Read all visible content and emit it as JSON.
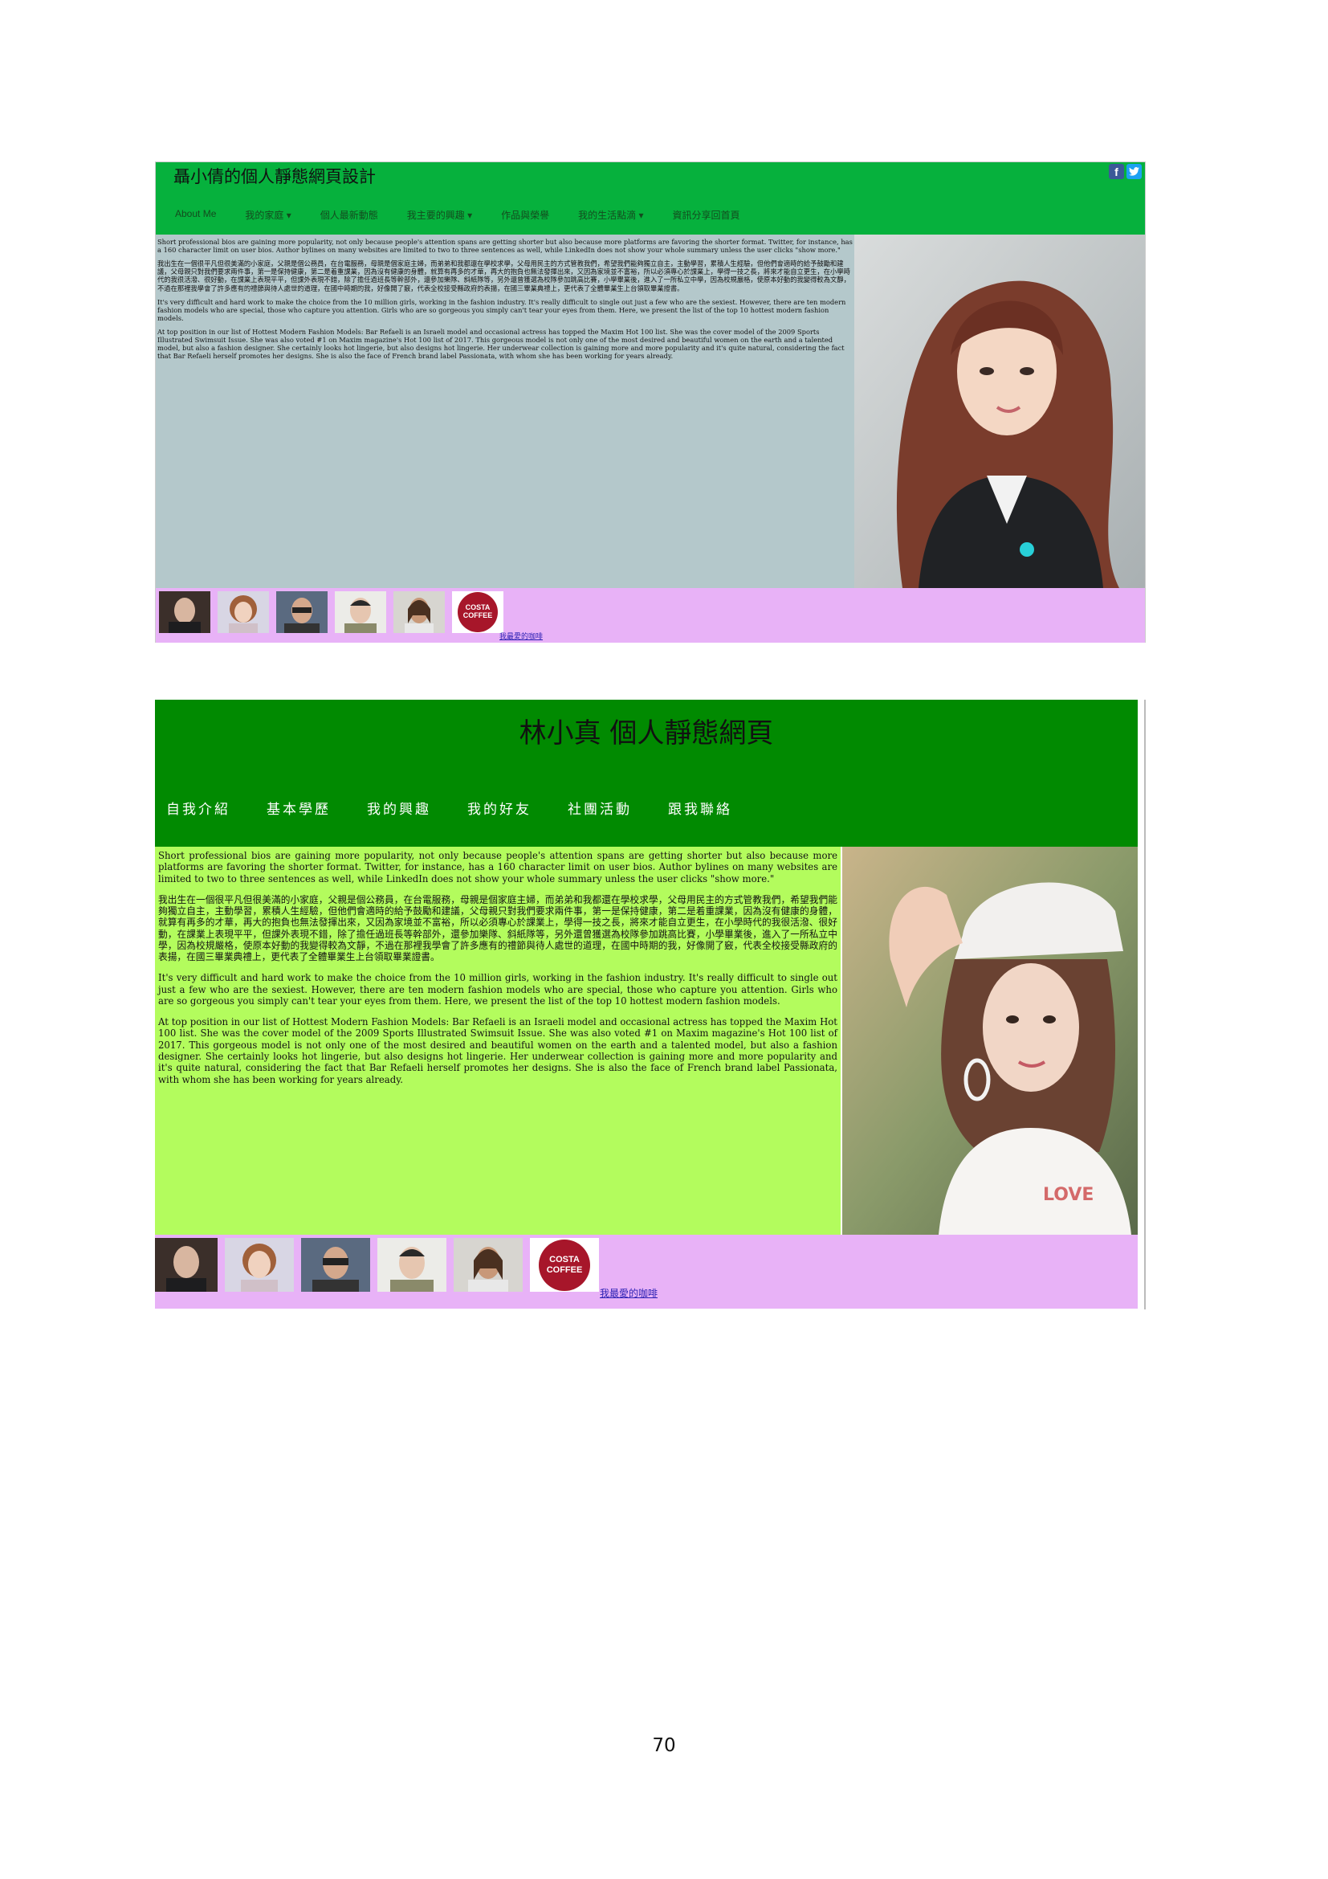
{
  "screenshot1": {
    "title": "聶小倩的個人靜態網頁設計",
    "social": {
      "facebook": "f",
      "twitter": "t"
    },
    "nav": [
      "About Me",
      "我的家庭 ▾",
      "個人最新動態",
      "我主要的興趣 ▾",
      "作品與榮譽",
      "我的生活點滴 ▾",
      "資訊分享回首頁"
    ],
    "paragraphs": [
      "Short professional bios are gaining more popularity, not only because people's attention spans are getting shorter but also because more platforms are favoring the shorter format. Twitter, for instance, has a 160 character limit on user bios. Author bylines on many websites are limited to two to three sentences as well, while LinkedIn does not show your whole summary unless the user clicks \"show more.\"",
      "我出生在一個很平凡但很美滿的小家庭，父親是個公務員，在台電服務，母親是個家庭主婦，而弟弟和我都還在學校求學，父母用民主的方式管教我們，希望我們能夠獨立自主，主動學習，累積人生經驗，但他們會適時的給予鼓勵和建議，父母親只對我們要求兩件事，第一是保持健康，第二是着重課業，因為沒有健康的身體，就算有再多的才華，再大的抱負也無法發揮出來，又因為家境並不富裕，所以必須專心於課業上，學得一技之長，將來才能自立更生，在小學時代的我很活潑、很好動，在課業上表現平平，但課外表現不錯，除了擔任過班長等幹部外，還參加樂隊、斜紙隊等，另外還曾獲選為校隊參加跳高比賽，小學畢業後，進入了一所私立中學，因為校規嚴格，使原本好動的我變得較為文靜，不過在那裡我學會了許多應有的禮節與待人處世的道理，在國中時期的我，好像開了竅，代表全校接受縣政府的表揚，在國三畢業典禮上，更代表了全體畢業生上台領取畢業證書。",
      "It's very difficult and hard work to make the choice from the 10 million girls, working in the fashion industry. It's really difficult to single out just a few who are the sexiest. However, there are ten modern fashion models who are special, those who capture you attention. Girls who are so gorgeous you simply can't tear your eyes from them. Here, we present the list of the top 10 hottest modern fashion models.",
      "At top position in our list of Hottest Modern Fashion Models: Bar Refaeli is an Israeli model and occasional actress has topped the Maxim Hot 100 list. She was the cover model of the 2009 Sports Illustrated Swimsuit Issue. She was also voted #1 on Maxim magazine's Hot 100 list of 2017. This gorgeous model is not only one of the most desired and beautiful women on the earth and a talented model, but also a fashion designer. She certainly looks hot lingerie, but also designs hot lingerie. Her underwear collection is gaining more and more popularity and it's quite natural, considering the fact that Bar Refaeli herself promotes her designs. She is also the face of French brand label Passionata, with whom she has been working for years already."
    ],
    "costa_logo_text": "COSTA COFFEE",
    "footer_link": "我最愛的咖啡"
  },
  "screenshot2": {
    "title": "林小真 個人靜態網頁",
    "nav": [
      "自我介紹",
      "基本學歷",
      "我的興趣",
      "我的好友",
      "社團活動",
      "跟我聯絡"
    ],
    "paragraphs": [
      "Short professional bios are gaining more popularity, not only because people's attention spans are getting shorter but also because more platforms are favoring the shorter format. Twitter, for instance, has a 160 character limit on user bios. Author bylines on many websites are limited to two to three sentences as well, while LinkedIn does not show your whole summary unless the user clicks \"show more.\"",
      "我出生在一個很平凡但很美滿的小家庭，父親是個公務員，在台電服務，母親是個家庭主婦，而弟弟和我都還在學校求學，父母用民主的方式管教我們，希望我們能夠獨立自主，主動學習，累積人生經驗，但他們會適時的給予鼓勵和建議，父母親只對我們要求兩件事，第一是保持健康，第二是着重課業，因為沒有健康的身體，就算有再多的才華，再大的抱負也無法發揮出來，又因為家境並不富裕，所以必須專心於課業上，學得一技之長，將來才能自立更生，在小學時代的我很活潑、很好動，在課業上表現平平，但課外表現不錯，除了擔任過班長等幹部外，還參加樂隊、斜紙隊等，另外還曾獲選為校隊參加跳高比賽，小學畢業後，進入了一所私立中學，因為校規嚴格，使原本好動的我變得較為文靜，不過在那裡我學會了許多應有的禮節與待人處世的道理，在國中時期的我，好像開了竅，代表全校接受縣政府的表揚，在國三畢業典禮上，更代表了全體畢業生上台領取畢業證書。",
      "It's very difficult and hard work to make the choice from the 10 million girls, working in the fashion industry. It's really difficult to single out just a few who are the sexiest. However, there are ten modern fashion models who are special, those who capture you attention. Girls who are so gorgeous you simply can't tear your eyes from them. Here, we present the list of the top 10 hottest modern fashion models.",
      "At top position in our list of Hottest Modern Fashion Models: Bar Refaeli is an Israeli model and occasional actress has topped the Maxim Hot 100 list. She was the cover model of the 2009 Sports Illustrated Swimsuit Issue. She was also voted #1 on Maxim magazine's Hot 100 list of 2017. This gorgeous model is not only one of the most desired and beautiful women on the earth and a talented model, but also a fashion designer. She certainly looks hot lingerie, but also designs hot lingerie. Her underwear collection is gaining more and more popularity and it's quite natural, considering the fact that Bar Refaeli herself promotes her designs. She is also the face of French brand label Passionata, with whom she has been working for years already."
    ],
    "costa_logo_text": "COSTA COFFEE",
    "footer_link": "我最愛的咖啡"
  },
  "page_number": "70"
}
